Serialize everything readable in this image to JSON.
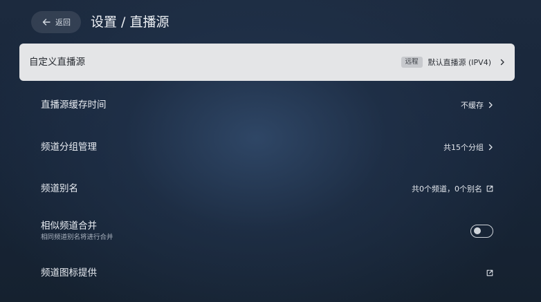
{
  "header": {
    "back_label": "返回",
    "title": "设置 / 直播源"
  },
  "rows": [
    {
      "title": "自定义直播源",
      "tag": "远程",
      "value": "默认直播源 (IPV4)",
      "indicator": "chevron-right-icon",
      "active": true
    },
    {
      "title": "直播源缓存时间",
      "value": "不缓存",
      "indicator": "chevron-right-icon"
    },
    {
      "title": "频道分组管理",
      "value": "共15个分组",
      "indicator": "chevron-right-icon"
    },
    {
      "title": "频道别名",
      "value": "共0个频道，0个别名",
      "indicator": "external-link-icon"
    },
    {
      "title": "相似频道合并",
      "subtitle": "相同频道别名将进行合并",
      "toggle": false
    },
    {
      "title": "频道图标提供",
      "indicator": "external-link-icon"
    }
  ],
  "colors": {
    "active_row_bg": "#e4e5e7",
    "background_dark": "#15212f",
    "background_glow": "#304868",
    "text_primary": "#e8ecf2"
  }
}
